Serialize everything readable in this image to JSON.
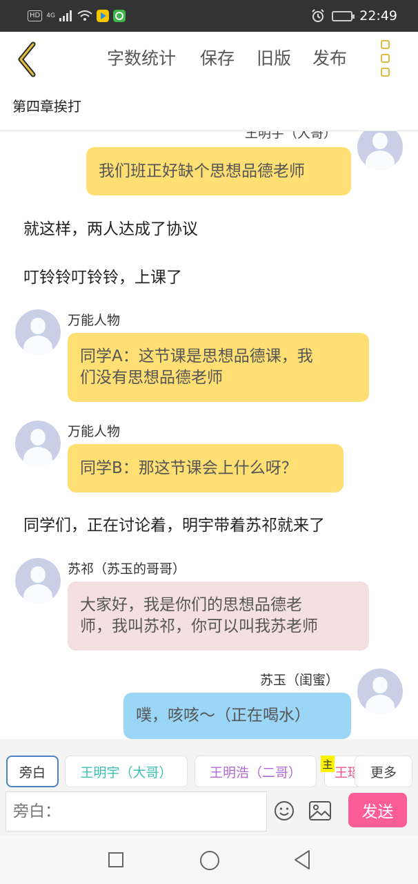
{
  "status_bar": {
    "hd_badge": "HD",
    "signal_label": "4G",
    "time": "22:49",
    "icons": [
      "hd-icon",
      "signal-icon",
      "wifi-icon",
      "video-app-icon",
      "game-app-icon",
      "alarm-icon",
      "battery-icon"
    ]
  },
  "toolbar": {
    "back_icon": "chevron-left-icon",
    "word_count": "字数统计",
    "save": "保存",
    "old_version": "旧版",
    "publish": "发布",
    "more_icon": "vertical-dots-icon",
    "accent_color": "#e0b93c"
  },
  "chapter": {
    "title": "第四章挨打"
  },
  "chat": {
    "partial_speaker": "王明宇（大哥）",
    "messages": [
      {
        "kind": "bubble",
        "side": "right",
        "speaker": "",
        "color": "#fedf74",
        "lines": [
          "我们班正好缺个思想品德老师"
        ]
      },
      {
        "kind": "narration",
        "text": "就这样，两人达成了协议"
      },
      {
        "kind": "narration",
        "text": "叮铃铃叮铃铃，上课了"
      },
      {
        "kind": "bubble",
        "side": "left",
        "speaker": "万能人物",
        "color": "#fedf74",
        "lines": [
          "同学A：这节课是思想品德课，我",
          "们没有思想品德老师"
        ]
      },
      {
        "kind": "bubble",
        "side": "left",
        "speaker": "万能人物",
        "color": "#fedf74",
        "lines": [
          "同学B：那这节课会上什么呀？"
        ]
      },
      {
        "kind": "narration",
        "text": "同学们，正在讨论着，明宇带着苏祁就来了"
      },
      {
        "kind": "bubble",
        "side": "left",
        "speaker": "苏祁（苏玉的哥哥）",
        "color": "#f4dfe1",
        "lines": [
          "大家好，我是你们的思想品德老",
          "师，我叫苏祁，你可以叫我苏老师"
        ]
      },
      {
        "kind": "bubble",
        "side": "right",
        "speaker": "苏玉（闺蜜）",
        "color": "#9bd6f7",
        "lines": [
          "噗，咳咳～（正在喝水）"
        ]
      }
    ]
  },
  "characters": {
    "items": [
      {
        "label": "旁白",
        "color": "#333333",
        "active": true
      },
      {
        "label": "王明宇（大哥）",
        "color": "#3cc0b4",
        "active": false
      },
      {
        "label": "王明浩（二哥）",
        "color": "#b06ad0",
        "active": false
      },
      {
        "label": "王瑶",
        "color": "#f0508c",
        "active": false
      }
    ],
    "main_tag": "主",
    "more": "更多"
  },
  "input": {
    "placeholder": "旁白：",
    "emoji_icon": "smiley-icon",
    "image_icon": "image-icon",
    "send": "发送",
    "send_color": "#fd5d96"
  },
  "android_nav": {
    "icons": [
      "recent-apps-icon",
      "home-icon",
      "back-icon"
    ]
  }
}
